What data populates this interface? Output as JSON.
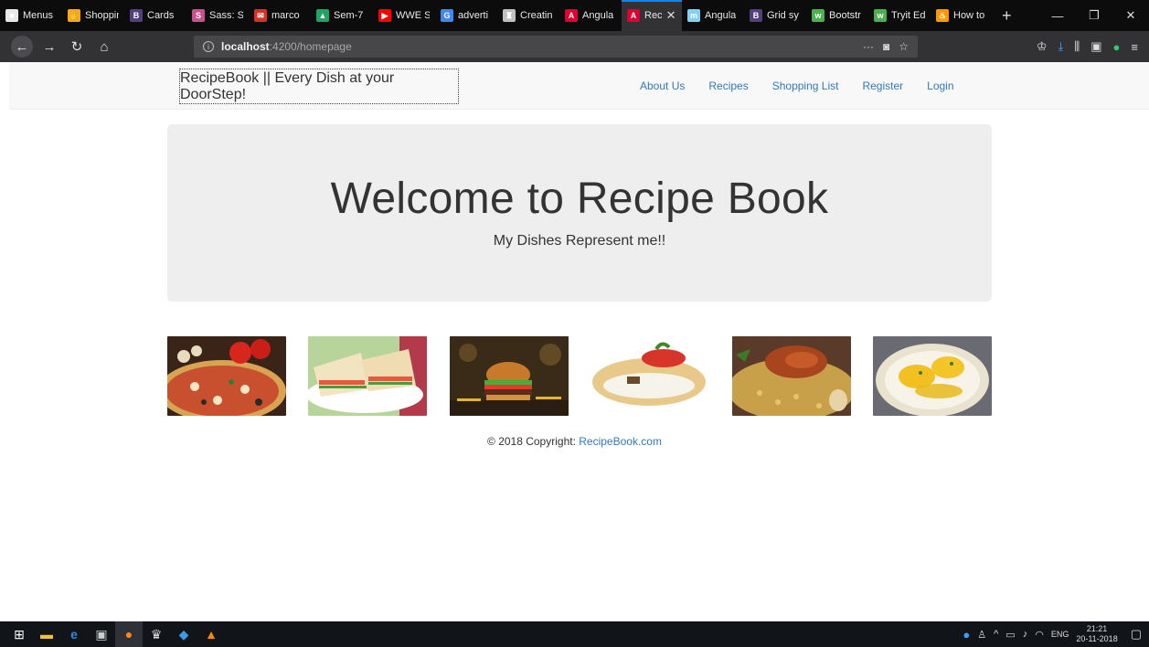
{
  "browser": {
    "tabs": [
      {
        "title": "Menus",
        "icon": "page-icon",
        "color": "#e8e8e8",
        "glyph": "■"
      },
      {
        "title": "Shoppin",
        "icon": "hand-icon",
        "color": "#f5a623",
        "glyph": "✋"
      },
      {
        "title": "Cards",
        "icon": "bootstrap-icon",
        "color": "#563d7c",
        "glyph": "B"
      },
      {
        "title": "Sass: Sy",
        "icon": "sass-icon",
        "color": "#c6538c",
        "glyph": "S"
      },
      {
        "title": "marco",
        "icon": "mail-icon",
        "color": "#d93025",
        "glyph": "✉"
      },
      {
        "title": "Sem-7",
        "icon": "drive-icon",
        "color": "#1fa463",
        "glyph": "▲"
      },
      {
        "title": "WWE S",
        "icon": "youtube-icon",
        "color": "#ff0000",
        "glyph": "▶"
      },
      {
        "title": "adverti",
        "icon": "google-icon",
        "color": "#4285f4",
        "glyph": "G"
      },
      {
        "title": "Creatin",
        "icon": "cup-icon",
        "color": "#c0c0c0",
        "glyph": "♜"
      },
      {
        "title": "Angula",
        "icon": "angular-icon",
        "color": "#dd0031",
        "glyph": "A"
      },
      {
        "title": "Rec",
        "icon": "angular-icon",
        "color": "#dd0031",
        "glyph": "A",
        "active": true
      },
      {
        "title": "Angula",
        "icon": "mdn-icon",
        "color": "#83d0f2",
        "glyph": "m"
      },
      {
        "title": "Grid sy",
        "icon": "bootstrap-icon",
        "color": "#563d7c",
        "glyph": "B"
      },
      {
        "title": "Bootstr",
        "icon": "w3-icon",
        "color": "#4caf50",
        "glyph": "w"
      },
      {
        "title": "Tryit Ed",
        "icon": "w3-icon",
        "color": "#4caf50",
        "glyph": "w"
      },
      {
        "title": "How to",
        "icon": "flame-icon",
        "color": "#ff9800",
        "glyph": "♨"
      }
    ],
    "url_host": "localhost",
    "url_path": ":4200/homepage"
  },
  "site": {
    "brand": "RecipeBook || Every Dish at your DoorStep!",
    "nav": [
      "About Us",
      "Recipes",
      "Shopping List",
      "Register",
      "Login"
    ]
  },
  "jumbotron": {
    "title": "Welcome to Recipe Book",
    "subtitle": "My Dishes Represent me!!"
  },
  "footer": {
    "prefix": "© 2018 Copyright: ",
    "link": "RecipeBook.com"
  },
  "taskbar": {
    "lang": "ENG",
    "time": "21:21",
    "date": "20-11-2018"
  }
}
